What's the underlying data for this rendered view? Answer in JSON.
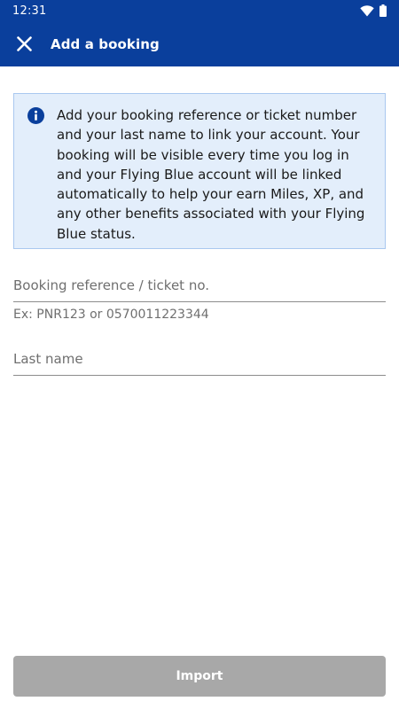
{
  "status_bar": {
    "time": "12:31",
    "icons": [
      "wifi-icon",
      "battery-icon"
    ]
  },
  "app_bar": {
    "close_icon": "close-icon",
    "title": "Add a booking",
    "background_color": "#0a3f9c"
  },
  "info": {
    "icon": "info-icon",
    "text": "Add your booking reference or ticket number and your last name to link your account. Your booking will be visible every time you log in and your Flying Blue account will be linked automatically to help your earn Miles, XP, and any other benefits associated with your Flying Blue status.",
    "background_color": "#e3eefb",
    "icon_color": "#0a3f9c"
  },
  "form": {
    "booking_reference": {
      "placeholder": "Booking reference / ticket no.",
      "value": "",
      "helper": "Ex: PNR123 or 0570011223344"
    },
    "last_name": {
      "placeholder": "Last name",
      "value": ""
    }
  },
  "actions": {
    "import_label": "Import",
    "import_disabled_color": "#a8a8a8"
  }
}
